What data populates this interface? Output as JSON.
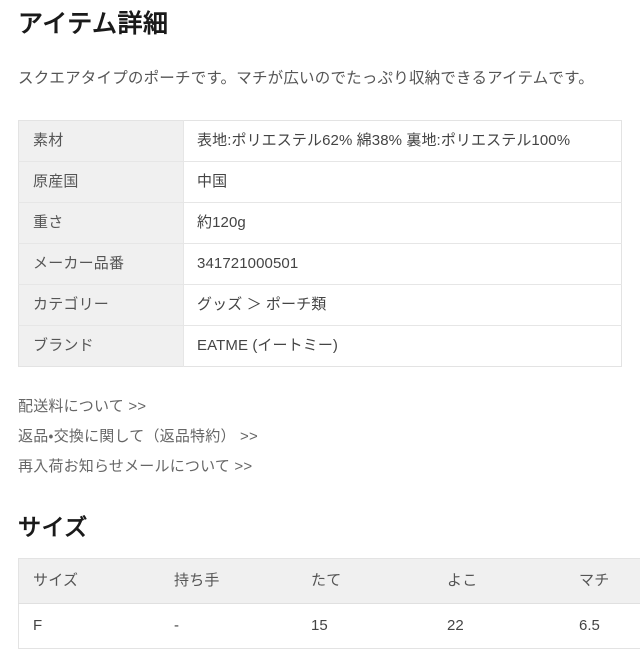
{
  "item_detail": {
    "heading": "アイテム詳細",
    "description": "スクエアタイプのポーチです。マチが広いのでたっぷり収納できるアイテムです。",
    "spec_rows": [
      {
        "label": "素材",
        "value": "表地:ポリエステル62% 綿38% 裏地:ポリエステル100%"
      },
      {
        "label": "原産国",
        "value": "中国"
      },
      {
        "label": "重さ",
        "value": "約120g"
      },
      {
        "label": "メーカー品番",
        "value": "341721000501"
      },
      {
        "label": "カテゴリー",
        "value": "グッズ ＞ ポーチ類"
      },
      {
        "label": "ブランド",
        "value": "EATME (イートミー)"
      }
    ]
  },
  "links": [
    {
      "label": "配送料について >>"
    },
    {
      "label": "返品・交換に関して（返品特約） >>"
    },
    {
      "label": "再入荷お知らせメールについて >>"
    }
  ],
  "size": {
    "heading": "サイズ",
    "columns": [
      "サイズ",
      "持ち手",
      "たて",
      "よこ",
      "マチ"
    ],
    "rows": [
      {
        "size": "F",
        "handle": "-",
        "length": "15",
        "width": "22",
        "gusset": "6.5"
      }
    ]
  },
  "colors": {
    "page_background": "#ffffff",
    "heading_text": "#1a1a1a",
    "body_text": "#444444",
    "muted_text": "#555555",
    "link_text": "#666666",
    "table_header_background": "#f0f0f0",
    "table_border": "#e3e3e3"
  }
}
